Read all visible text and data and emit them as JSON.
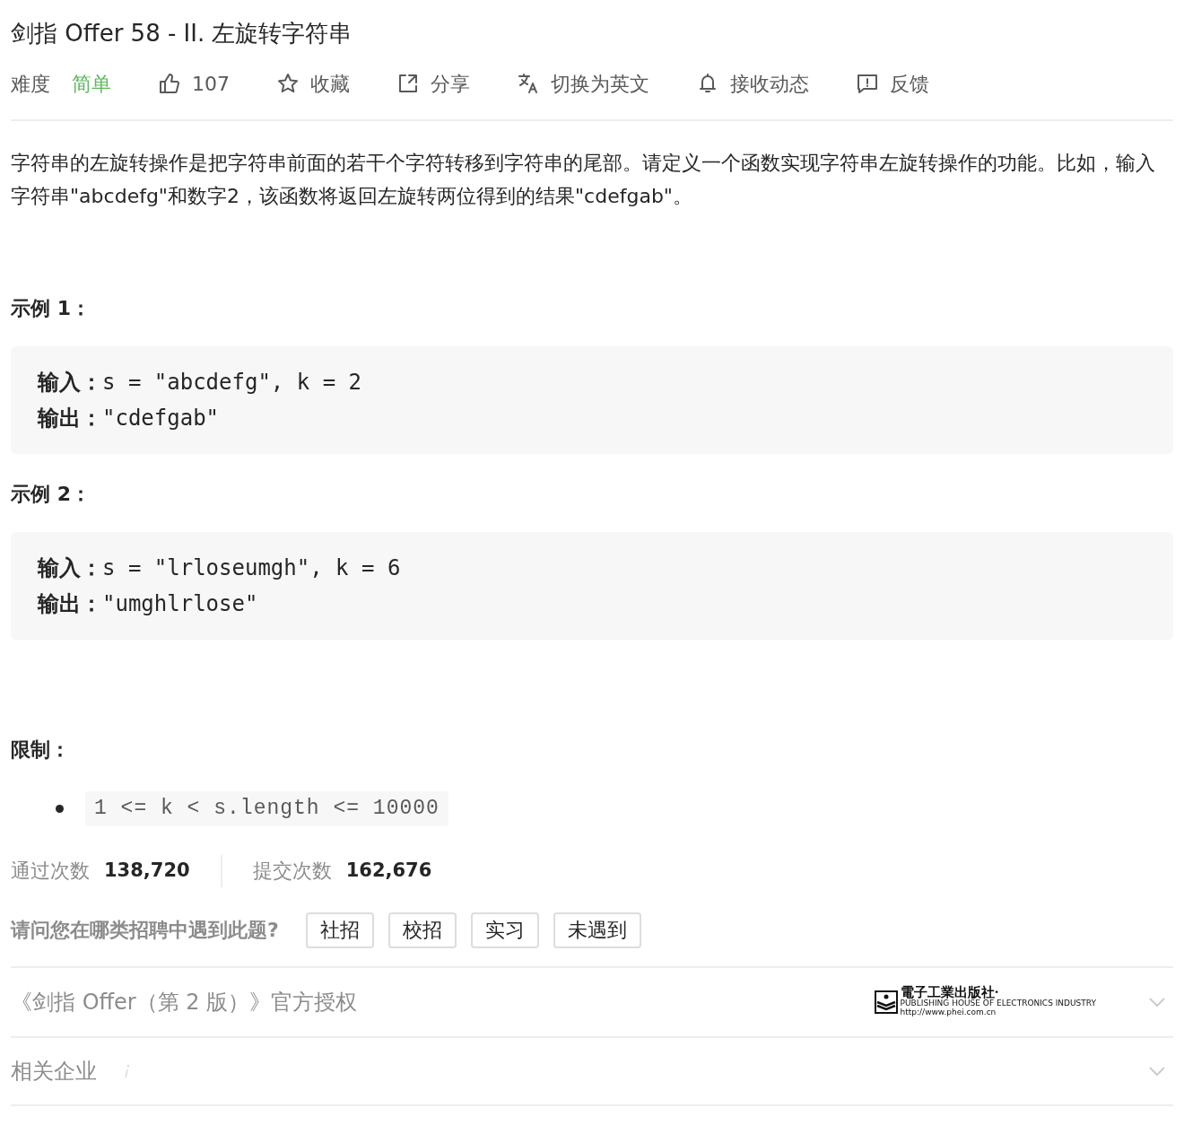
{
  "title": "剑指 Offer 58 - II. 左旋转字符串",
  "meta": {
    "difficulty_label": "难度",
    "difficulty": "简单"
  },
  "actions": [
    {
      "kind": "like",
      "label": "107"
    },
    {
      "kind": "star",
      "label": "收藏"
    },
    {
      "kind": "share",
      "label": "分享"
    },
    {
      "kind": "translate",
      "label": "切换为英文"
    },
    {
      "kind": "bell",
      "label": "接收动态"
    },
    {
      "kind": "feedback",
      "label": "反馈"
    }
  ],
  "description": "字符串的左旋转操作是把字符串前面的若干个字符转移到字符串的尾部。请定义一个函数实现字符串左旋转操作的功能。比如，输入字符串\"abcdefg\"和数字2，该函数将返回左旋转两位得到的结果\"cdefgab\"。",
  "examples": [
    {
      "heading": "示例 1：",
      "lines": [
        {
          "label": "输入：",
          "text": "s = \"abcdefg\", k = 2"
        },
        {
          "label": "输出：",
          "text": "\"cdefgab\""
        }
      ]
    },
    {
      "heading": "示例 2：",
      "lines": [
        {
          "label": "输入：",
          "text": "s = \"lrloseumgh\", k = 6"
        },
        {
          "label": "输出：",
          "text": "\"umghlrlose\""
        }
      ]
    }
  ],
  "constraints_heading": "限制：",
  "constraints": [
    "1 <= k < s.length <= 10000"
  ],
  "stats": [
    {
      "label": "通过次数",
      "value": "138,720"
    },
    {
      "label": "提交次数",
      "value": "162,676"
    }
  ],
  "survey": {
    "question": "请问您在哪类招聘中遇到此题?",
    "options": [
      "社招",
      "校招",
      "实习",
      "未遇到"
    ]
  },
  "sections": [
    {
      "kind": "publisher",
      "label": "《剑指 Offer（第 2 版）》官方授权",
      "logo": {
        "name": "電子工業出版社·",
        "subtitle": "PUBLISHING HOUSE OF ELECTRONICS INDUSTRY",
        "url": "http://www.phei.com.cn"
      }
    },
    {
      "kind": "companies",
      "label": "相关企业"
    }
  ]
}
